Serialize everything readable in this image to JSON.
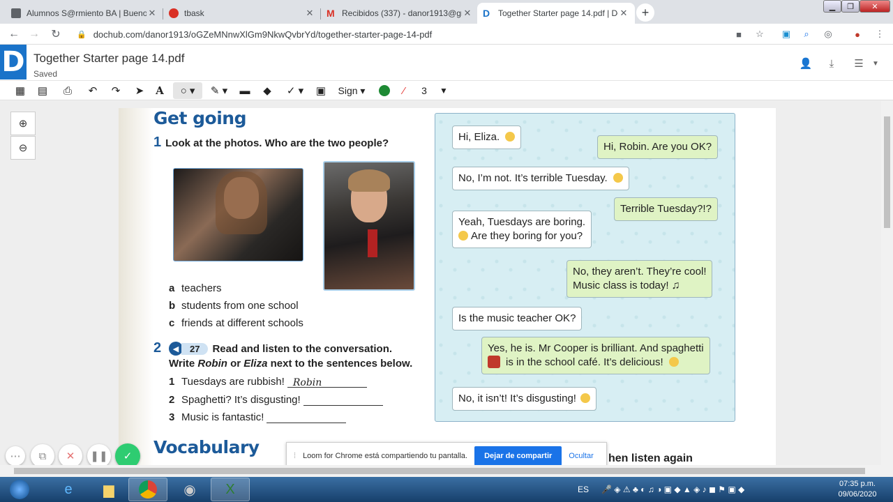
{
  "browser": {
    "tabs": [
      {
        "title": "Alumnos S@rmiento BA | Buenos",
        "favicon": "classroom-icon",
        "active": false
      },
      {
        "title": "tbask",
        "favicon": "tbask-icon",
        "active": false
      },
      {
        "title": "Recibidos (337) - danor1913@gm",
        "favicon": "gmail-icon",
        "active": false
      },
      {
        "title": "Together Starter page 14.pdf | Do",
        "favicon": "dochub-icon",
        "active": true
      }
    ],
    "url": "dochub.com/danor1913/oGZeMNnwXlGm9NkwQvbrYd/together-starter-page-14-pdf"
  },
  "app": {
    "logo": "D",
    "doc_title": "Together Starter page 14.pdf",
    "status": "Saved",
    "toolbar": {
      "sign_label": "Sign",
      "color": "#1e8a34",
      "stroke_width": "3"
    }
  },
  "page": {
    "section1_title": "Get going",
    "q1_number": "1",
    "q1_text": "Look at the photos. Who are the two people?",
    "options": [
      {
        "letter": "a",
        "text": "teachers"
      },
      {
        "letter": "b",
        "text": "students from one school"
      },
      {
        "letter": "c",
        "text": "friends at different schools"
      }
    ],
    "q2_number": "2",
    "audio_track": "27",
    "q2_line1": "Read and listen to the conversation.",
    "q2_line2_a": "Write ",
    "q2_line2_robin": "Robin",
    "q2_line2_or": " or ",
    "q2_line2_eliza": "Eliza",
    "q2_line2_b": " next to the sentences below.",
    "sentences": [
      {
        "num": "1",
        "text": "Tuesdays are rubbish!",
        "answer": "Robin"
      },
      {
        "num": "2",
        "text": "Spaghetti? It’s disgusting!",
        "answer": ""
      },
      {
        "num": "3",
        "text": "Music is fantastic!",
        "answer": ""
      }
    ],
    "section2_title": "Vocabulary",
    "partial_text": "hen listen again"
  },
  "chat": [
    {
      "side": "left",
      "text": "Hi, Eliza."
    },
    {
      "side": "right",
      "text": "Hi, Robin. Are you OK?"
    },
    {
      "side": "left",
      "text": "No, I’m not. It’s terrible Tuesday."
    },
    {
      "side": "right",
      "text": "Terrible Tuesday?!?"
    },
    {
      "side": "left",
      "line1": "Yeah, Tuesdays are boring.",
      "line2": "Are they boring for you?"
    },
    {
      "side": "right",
      "line1": "No, they aren’t. They’re cool!",
      "line2": "Music class is today!"
    },
    {
      "side": "left",
      "text": "Is the music teacher OK?"
    },
    {
      "side": "right",
      "line1": "Yes, he is. Mr Cooper is brilliant. And spaghetti",
      "line2": "is in the school café. It’s delicious!"
    },
    {
      "side": "left",
      "text": "No, it isn’t! It’s disgusting!"
    }
  ],
  "loom": {
    "message": "Loom for Chrome está compartiendo tu pantalla.",
    "stop_label": "Dejar de compartir",
    "hide_label": "Ocultar"
  },
  "taskbar": {
    "lang": "ES",
    "time": "07:35 p.m.",
    "date": "09/06/2020"
  }
}
